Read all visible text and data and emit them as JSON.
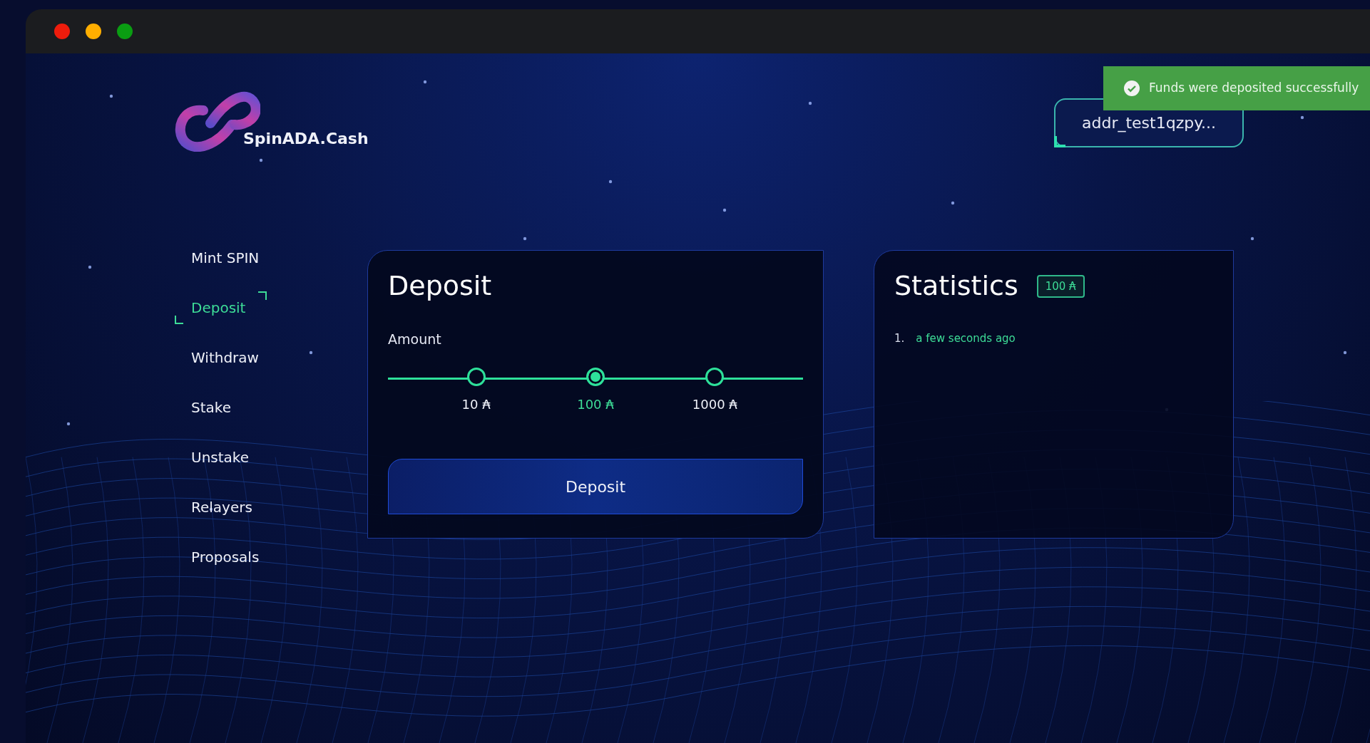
{
  "window": {
    "controls": [
      {
        "kind": "close"
      },
      {
        "kind": "minimize"
      },
      {
        "kind": "maximize"
      }
    ]
  },
  "logo": {
    "text": "SpinADA.Cash"
  },
  "wallet": {
    "address": "addr_test1qzpy..."
  },
  "toast": {
    "message": "Funds were deposited successfully"
  },
  "nav": [
    {
      "label": "Mint SPIN",
      "selected": false
    },
    {
      "label": "Deposit",
      "selected": true
    },
    {
      "label": "Withdraw",
      "selected": false
    },
    {
      "label": "Stake",
      "selected": false
    },
    {
      "label": "Unstake",
      "selected": false
    },
    {
      "label": "Relayers",
      "selected": false
    },
    {
      "label": "Proposals",
      "selected": false
    }
  ],
  "deposit": {
    "title": "Deposit",
    "amount_label": "Amount",
    "amounts": [
      {
        "label": "10 ₳",
        "selected": false
      },
      {
        "label": "100 ₳",
        "selected": true
      },
      {
        "label": "1000 ₳",
        "selected": false
      }
    ],
    "button": "Deposit"
  },
  "statistics": {
    "title": "Statistics",
    "badge": "100 ₳",
    "items": [
      {
        "index": "1.",
        "text": "a few seconds ago"
      }
    ]
  }
}
